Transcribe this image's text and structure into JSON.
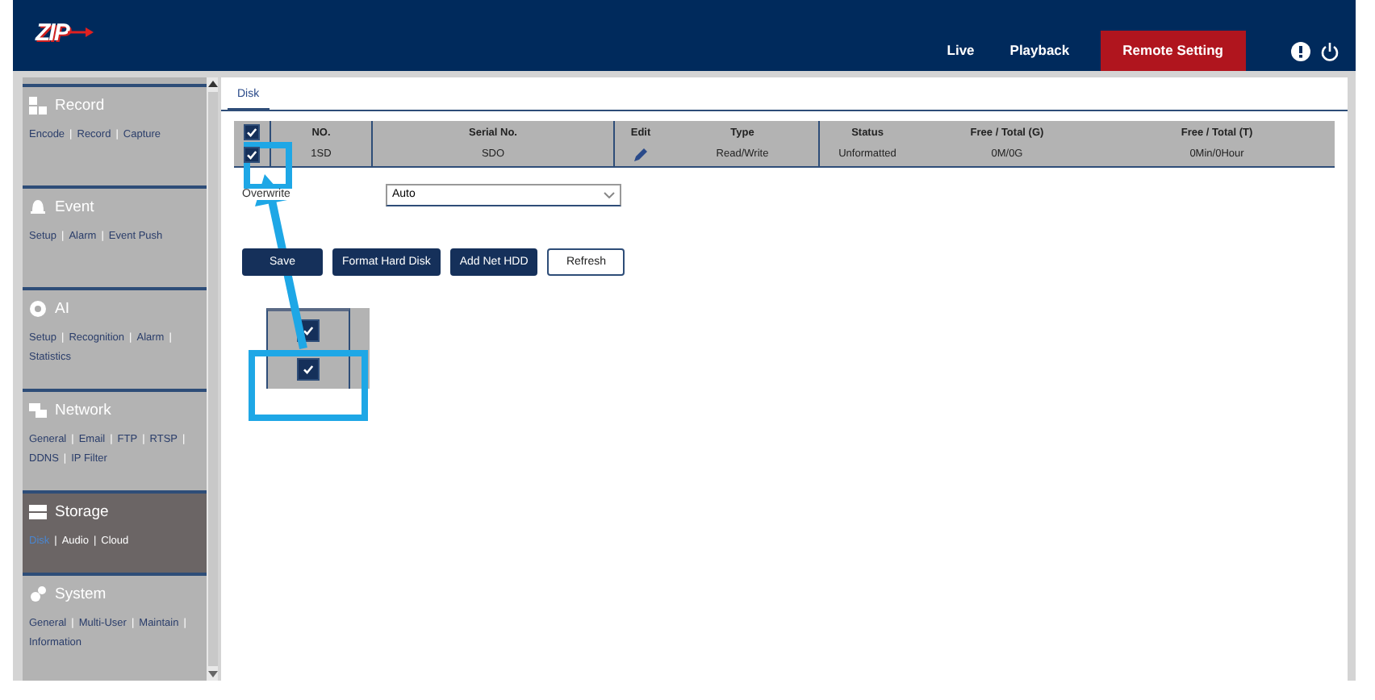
{
  "header": {
    "logo": "ZIP",
    "nav": [
      {
        "label": "Live",
        "selected": false
      },
      {
        "label": "Playback",
        "selected": false
      },
      {
        "label": "Remote Setting",
        "selected": true
      }
    ]
  },
  "sidebar": {
    "separator": "|",
    "sections": [
      {
        "kind": "record",
        "title": "Record",
        "selected": false,
        "links": [
          {
            "label": "Encode",
            "selected": false
          },
          {
            "label": "Record",
            "selected": false
          },
          {
            "label": "Capture",
            "selected": false
          }
        ]
      },
      {
        "kind": "event",
        "title": "Event",
        "selected": false,
        "links": [
          {
            "label": "Setup",
            "selected": false
          },
          {
            "label": "Alarm",
            "selected": false
          },
          {
            "label": "Event Push",
            "selected": false
          }
        ]
      },
      {
        "kind": "ai",
        "title": "AI",
        "selected": false,
        "links": [
          {
            "label": "Setup",
            "selected": false
          },
          {
            "label": "Recognition",
            "selected": false
          },
          {
            "label": "Alarm",
            "selected": false
          },
          {
            "label": "Statistics",
            "selected": false
          }
        ]
      },
      {
        "kind": "network",
        "title": "Network",
        "selected": false,
        "links": [
          {
            "label": "General",
            "selected": false
          },
          {
            "label": "Email",
            "selected": false
          },
          {
            "label": "FTP",
            "selected": false
          },
          {
            "label": "RTSP",
            "selected": false
          },
          {
            "label": "DDNS",
            "selected": false
          },
          {
            "label": "IP Filter",
            "selected": false
          }
        ]
      },
      {
        "kind": "storage",
        "title": "Storage",
        "selected": true,
        "links": [
          {
            "label": "Disk",
            "selected": true
          },
          {
            "label": "Audio",
            "selected": false
          },
          {
            "label": "Cloud",
            "selected": false
          }
        ]
      },
      {
        "kind": "system",
        "title": "System",
        "selected": false,
        "links": [
          {
            "label": "General",
            "selected": false
          },
          {
            "label": "Multi-User",
            "selected": false
          },
          {
            "label": "Maintain",
            "selected": false
          },
          {
            "label": "Information",
            "selected": false
          }
        ]
      }
    ]
  },
  "tabs": [
    {
      "label": "Disk",
      "selected": true
    }
  ],
  "table": {
    "header_checked": true,
    "columns": [
      "NO.",
      "Serial No.",
      "Edit",
      "Type",
      "Status",
      "Free / Total (G)",
      "Free / Total (T)"
    ],
    "rows": [
      {
        "checked": true,
        "cells": [
          "1SD",
          "SDO",
          "",
          "Read/Write",
          "Unformatted",
          "0M/0G",
          "0Min/0Hour"
        ]
      }
    ]
  },
  "overwrite": {
    "label": "Overwrite",
    "value": "Auto"
  },
  "buttons": [
    {
      "label": "Save",
      "kind": "primary"
    },
    {
      "label": "Format Hard Disk",
      "kind": "primary"
    },
    {
      "label": "Add Net HDD",
      "kind": "primary"
    },
    {
      "label": "Refresh",
      "kind": "outline"
    }
  ],
  "callout": {
    "checkboxes": [
      {
        "checked": true
      },
      {
        "checked": true
      }
    ]
  }
}
